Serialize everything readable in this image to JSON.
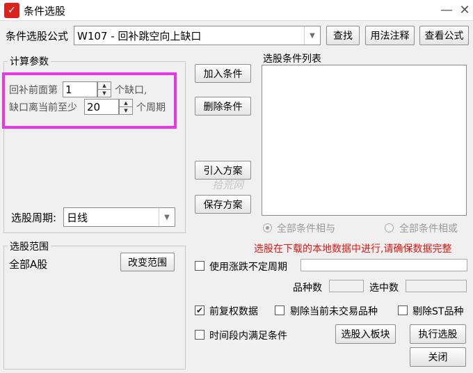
{
  "window": {
    "title": "条件选股",
    "icon": "ribbon-logo-icon",
    "minimize": "—",
    "close": "✕"
  },
  "formula": {
    "label": "条件选股公式",
    "value": "W107  -  回补跳空向上缺口",
    "search_button": "查找",
    "usage_button": "用法注释",
    "view_button": "查看公式"
  },
  "params": {
    "group_title": "计算参数",
    "line1_prefix": "回补前面第",
    "line1_value": "1",
    "line1_suffix": "个缺口,",
    "line2_prefix": "缺口离当前至少",
    "line2_value": "20",
    "line2_suffix": "个周期",
    "period_label": "选股周期:",
    "period_value": "日线"
  },
  "actions": {
    "add_condition": "加入条件",
    "delete_condition": "删除条件",
    "import_scheme": "引入方案",
    "save_scheme": "保存方案"
  },
  "watermark": "拾荒网",
  "condition_list": {
    "title": "选股条件列表",
    "logic_and": "全部条件相与",
    "logic_or": "全部条件相或"
  },
  "range": {
    "group_title": "选股范围",
    "value": "全部A股",
    "change_button": "改变范围"
  },
  "notice": "选股在下载的本地数据中进行,请确保数据完整",
  "options": {
    "variable_period": "使用涨跌不定周期",
    "stock_count_label": "品种数",
    "selected_count_label": "选中数",
    "pre_adjust": "前复权数据",
    "exclude_untraded": "剔除当前未交易品种",
    "exclude_st": "剔除ST品种",
    "time_period": "时间段内满足条件"
  },
  "bottom": {
    "to_block": "选股入板块",
    "execute": "执行选股",
    "close": "关闭"
  },
  "colors": {
    "notice_red": "#e8140f",
    "highlight_magenta": "#e836e8",
    "logo_red": "#d9231d"
  }
}
